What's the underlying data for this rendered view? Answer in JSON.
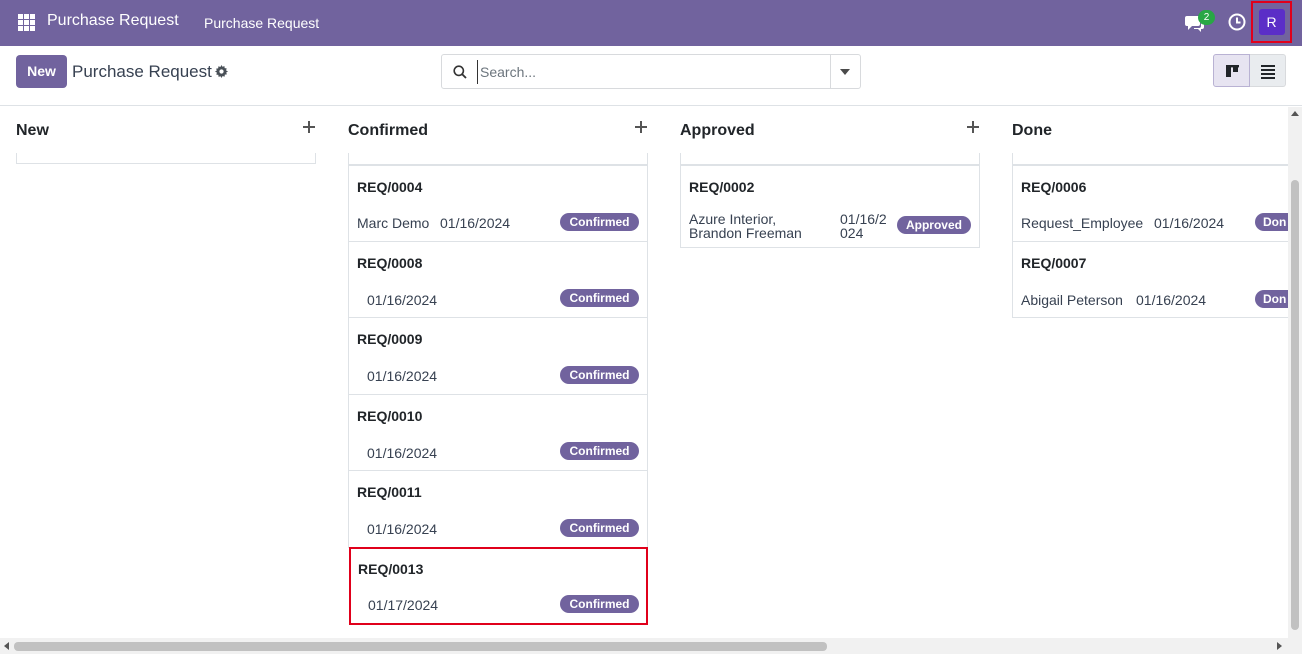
{
  "topbar": {
    "app_title": "Purchase Request",
    "menu_item": "Purchase Request",
    "chat_count": "2",
    "avatar_initial": "R"
  },
  "control": {
    "new_label": "New",
    "title": "Purchase Request",
    "search_placeholder": "Search..."
  },
  "columns": [
    {
      "title": "New",
      "cards": []
    },
    {
      "title": "Confirmed",
      "cards": [
        {
          "ref": "REQ/0004",
          "name": "Marc Demo",
          "date": "01/16/2024",
          "status": "Confirmed"
        },
        {
          "ref": "REQ/0008",
          "name": "",
          "date": "01/16/2024",
          "status": "Confirmed"
        },
        {
          "ref": "REQ/0009",
          "name": "",
          "date": "01/16/2024",
          "status": "Confirmed"
        },
        {
          "ref": "REQ/0010",
          "name": "",
          "date": "01/16/2024",
          "status": "Confirmed"
        },
        {
          "ref": "REQ/0011",
          "name": "",
          "date": "01/16/2024",
          "status": "Confirmed"
        },
        {
          "ref": "REQ/0013",
          "name": "",
          "date": "01/17/2024",
          "status": "Confirmed"
        }
      ]
    },
    {
      "title": "Approved",
      "cards": [
        {
          "ref": "REQ/0002",
          "name_line1": "Azure Interior,",
          "name_line2": "Brandon Freeman",
          "date_line1": "01/16/2",
          "date_line2": "024",
          "status": "Approved"
        }
      ]
    },
    {
      "title": "Done",
      "cards": [
        {
          "ref": "REQ/0006",
          "name": "Request_Employee",
          "date": "01/16/2024",
          "status": "Don"
        },
        {
          "ref": "REQ/0007",
          "name": "Abigail Peterson",
          "date": "01/16/2024",
          "status": "Don"
        }
      ]
    }
  ],
  "colors": {
    "brand": "#71639e",
    "badge_green": "#28a745",
    "avatar": "#5b2ec7",
    "highlight": "#e0001b"
  }
}
